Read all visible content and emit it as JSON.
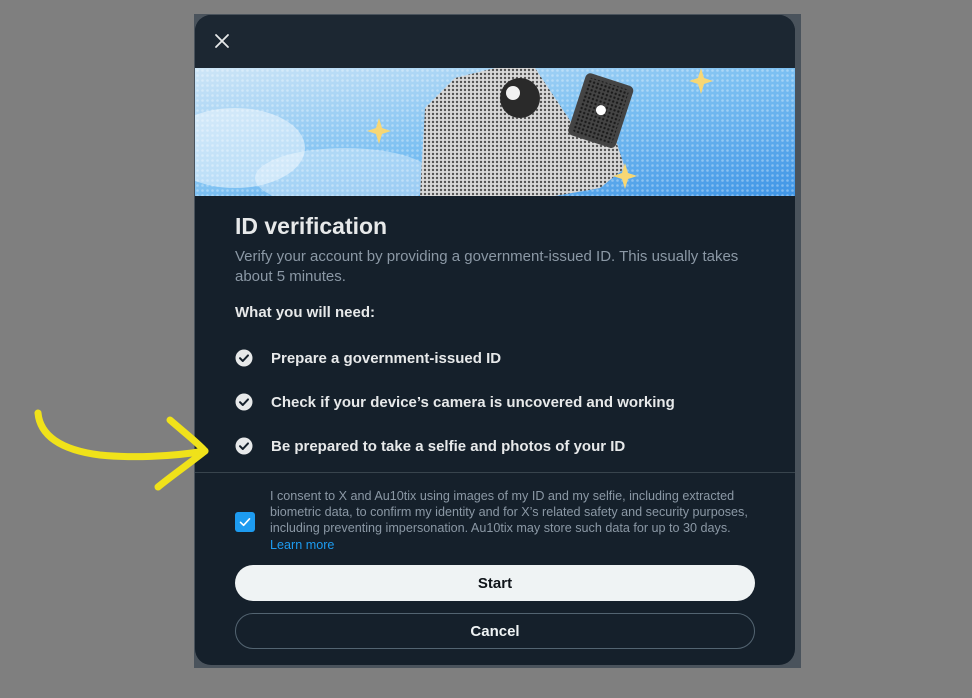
{
  "dialog": {
    "close_icon": "close-icon",
    "title": "ID verification",
    "subtitle": "Verify your account by providing a government-issued ID. This usually takes about 5 minutes.",
    "requirements_heading": "What you will need:",
    "requirements": [
      {
        "label": "Prepare a government-issued ID",
        "icon": "check-circle-icon"
      },
      {
        "label": "Check if your device’s camera is uncovered and working",
        "icon": "check-circle-icon"
      },
      {
        "label": "Be prepared to take a selfie and photos of your ID",
        "icon": "check-circle-icon"
      }
    ],
    "consent": {
      "checked": true,
      "text": "I consent to X and Au10tix using images of my ID and my selfie, including extracted biometric data, to confirm my identity and for X’s related safety and security purposes, including preventing impersonation. Au10tix may store such data for up to 30 days.",
      "link_label": "Learn more"
    },
    "start_label": "Start",
    "cancel_label": "Cancel"
  },
  "colors": {
    "accent": "#1d9bf0",
    "modal_bg": "#15202b",
    "annotation": "#f0e21a"
  }
}
